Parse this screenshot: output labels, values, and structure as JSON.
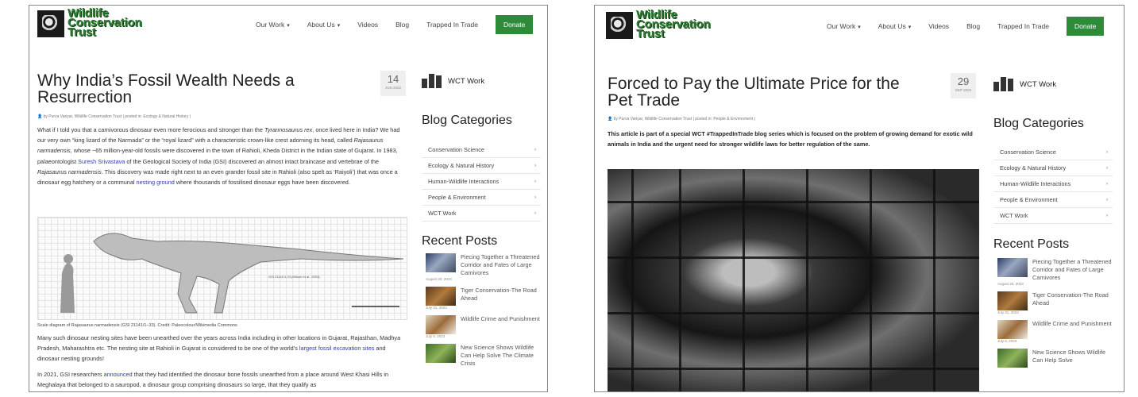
{
  "left": {
    "logo": [
      "Wildlife",
      "Conservation",
      "Trust"
    ],
    "nav": {
      "our_work": "Our Work",
      "about": "About Us",
      "videos": "Videos",
      "blog": "Blog",
      "trapped": "Trapped In Trade",
      "donate": "Donate"
    },
    "title_line1": "Why India’s Fossil Wealth Needs a",
    "title_line2": "Resurrection",
    "date_day": "14",
    "date_month": "JUN 2022",
    "meta": "by Purva Variyar, Wildlife Conservation Trust | posted in: Ecology & Natural History |",
    "para1_a": "What if I told you that a carnivorous dinosaur even more ferocious and stronger than the ",
    "para1_em": "Tyrannosaurus rex",
    "para1_b": ", once lived here in India? We had our very own “king lizard of the Narmada” or the “royal lizard” with a characteristic crown-like crest adorning its head, called ",
    "para1_em2": "Rajasaurus narmadensis",
    "para1_c": ", whose ~65 million-year-old fossils were discovered in the town of Rahioli, Kheda District in the Indian state of Gujarat. In 1983, palaeontologist ",
    "para1_link": "Suresh Srivastava",
    "para1_d": " of the Geological Society of India (GSI) discovered an almost intact braincase and vertebrae of the ",
    "para1_em3": "Rajasaurus narmadensis",
    "para1_e": ". This discovery was made right next to an even grander fossil site in Rahioli (also spelt as ‘Raiyoli’) that was once a dinosaur egg hatchery or a communal ",
    "para1_link2": "nesting ground",
    "para1_f": " where thousands of fossilised dinosaur eggs have been discovered.",
    "caption": "Scale diagram of Rajasaurus narmadensis (GSI 21141/1–33). Credit: Paleocolour/Wikimedia Commons",
    "para2_a": "Many such dinosaur nesting sites have been unearthed over the years across India including in other locations in Gujarat, Rajasthan, Madhya Pradesh, Maharashtra etc. The nesting site at Rahioli in Gujarat is considered to be one of the world’s ",
    "para2_link": "largest fossil excavation sites",
    "para2_b": " and dinosaur nesting grounds!",
    "para3_a": "In 2021, GSI researchers ",
    "para3_link": "announced",
    "para3_b": " that they had identified the dinosaur bone fossils unearthed from a place around West Khasi Hills in Meghalaya that belonged to a sauropod, a dinosaur group comprising dinosaurs so large, that they qualify as",
    "wct_work": "WCT Work",
    "blog_categories": "Blog Categories",
    "categories": [
      "Conservation Science",
      "Ecology & Natural History",
      "Human-Wildlife Interactions",
      "People & Environment",
      "WCT Work"
    ],
    "recent_posts": "Recent Posts",
    "posts": [
      {
        "title": "Piecing Together a Threatened Corridor and Fates of Large Carnivores",
        "date": "August 20, 2023"
      },
      {
        "title": "Tiger Conservation-The Road Ahead",
        "date": "July 31, 2023"
      },
      {
        "title": "Wildlife Crime and Punishment",
        "date": "July 6, 2023"
      },
      {
        "title": "New Science Shows Wildlife Can Help Solve The Climate Crisis",
        "date": ""
      }
    ]
  },
  "right": {
    "logo": [
      "Wildlife",
      "Conservation",
      "Trust"
    ],
    "nav": {
      "our_work": "Our Work",
      "about": "About Us",
      "videos": "Videos",
      "blog": "Blog",
      "trapped": "Trapped In Trade",
      "donate": "Donate"
    },
    "title_line1": "Forced to Pay the Ultimate Price for the",
    "title_line2": "Pet Trade",
    "date_day": "29",
    "date_month": "SEP 2022",
    "meta": "by Purva Variyar, Wildlife Conservation Trust | posted in: People & Environment |",
    "intro": "This article is part of a special WCT #TrappedInTrade blog series which is focused on the problem of growing demand for exotic wild animals in India and the urgent need for stronger wildlife laws for better regulation of the same.",
    "wct_work": "WCT Work",
    "blog_categories": "Blog Categories",
    "categories": [
      "Conservation Science",
      "Ecology & Natural History",
      "Human-Wildlife Interactions",
      "People & Environment",
      "WCT Work"
    ],
    "recent_posts": "Recent Posts",
    "posts": [
      {
        "title": "Piecing Together a Threatened Corridor and Fates of Large Carnivores",
        "date": "August 20, 2023"
      },
      {
        "title": "Tiger Conservation-The Road Ahead",
        "date": "July 31, 2023"
      },
      {
        "title": "Wildlife Crime and Punishment",
        "date": "July 6, 2023"
      },
      {
        "title": "New Science Shows Wildlife Can Help Solve",
        "date": ""
      }
    ]
  },
  "colors": {
    "brand_green": "#2e8b3a",
    "link_blue": "#2d3ba8"
  }
}
